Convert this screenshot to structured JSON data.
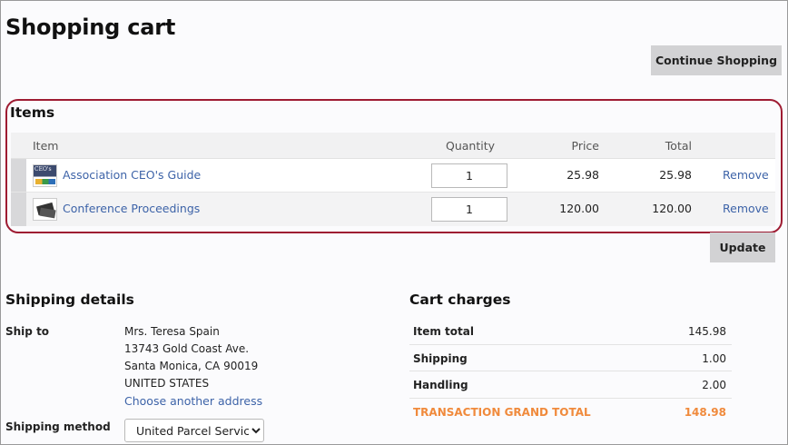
{
  "page": {
    "title": "Shopping cart",
    "continue_label": "Continue Shopping",
    "update_label": "Update"
  },
  "items": {
    "title": "Items",
    "headers": {
      "item": "Item",
      "quantity": "Quantity",
      "price": "Price",
      "total": "Total"
    },
    "rows": [
      {
        "name": "Association CEO's Guide",
        "quantity": "1",
        "price": "25.98",
        "total": "25.98",
        "remove": "Remove",
        "thumb": "book-cover-icon"
      },
      {
        "name": "Conference Proceedings",
        "quantity": "1",
        "price": "120.00",
        "total": "120.00",
        "remove": "Remove",
        "thumb": "cards-icon"
      }
    ],
    "thumb_text": "CEO's"
  },
  "shipping": {
    "title": "Shipping details",
    "ship_to_label": "Ship to",
    "address": [
      "Mrs. Teresa Spain",
      "13743 Gold Coast Ave.",
      "Santa Monica, CA 90019",
      "UNITED STATES"
    ],
    "change_link": "Choose another address",
    "method_label": "Shipping method",
    "method_selected": "United Parcel Service"
  },
  "charges": {
    "title": "Cart charges",
    "rows": [
      {
        "label": "Item total",
        "value": "145.98"
      },
      {
        "label": "Shipping",
        "value": "1.00"
      },
      {
        "label": "Handling",
        "value": "2.00"
      },
      {
        "label": "TRANSACTION GRAND TOTAL",
        "value": "148.98"
      }
    ]
  },
  "colors": {
    "accent_border": "#9e1b32",
    "link": "#3d63a8",
    "grand_total": "#f08a3c",
    "button_bg": "#d2d2d4"
  }
}
